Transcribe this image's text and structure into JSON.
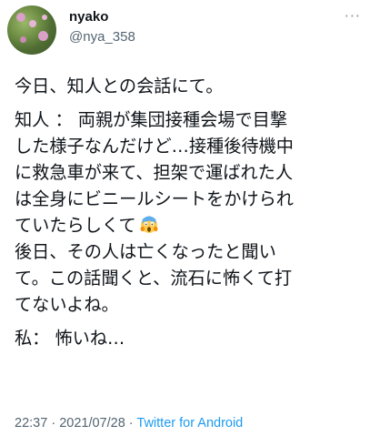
{
  "author": {
    "display_name": "nyako",
    "handle": "@nya_358"
  },
  "menu": {
    "more_icon": "more-horizontal-icon",
    "more_glyph": "···"
  },
  "tweet": {
    "lines": [
      "今日、知人との会話にて。",
      "",
      "知人 ： 両親が集団接種会場で目撃",
      "した様子なんだけど…接種後待機中",
      "に救急車が来て、担架で運ばれた人",
      "は全身にビニールシートをかけられ",
      "ていたらしくて",
      "後日、その人は亡くなったと聞い",
      "て。この話聞くと、流石に怖くて打",
      "てないよね。",
      "",
      "私： 怖いね…"
    ],
    "emoji": "face-screaming-in-fear"
  },
  "meta": {
    "time": "22:37",
    "separator1": " · ",
    "date": "2021/07/28",
    "separator2": " · ",
    "source": "Twitter for Android"
  },
  "colors": {
    "text": "#0f1419",
    "secondary": "#536471",
    "link": "#1d9bf0"
  }
}
